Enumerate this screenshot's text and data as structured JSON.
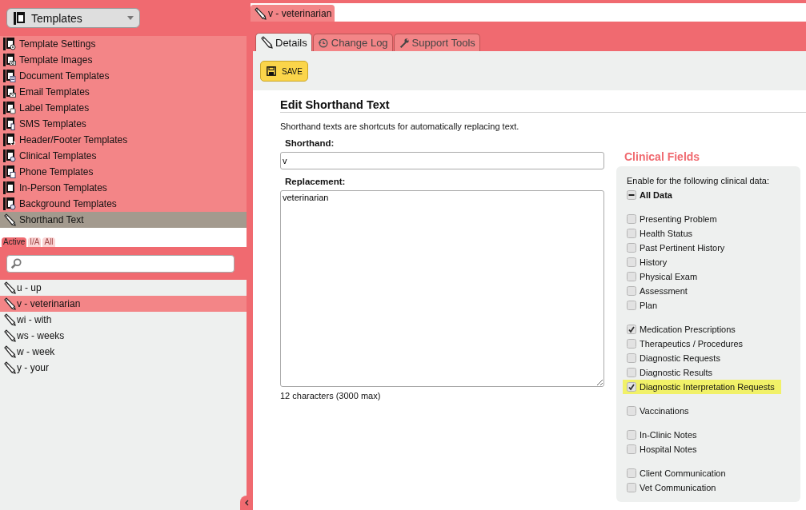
{
  "sidebar": {
    "module_select": {
      "label": "Templates"
    },
    "menu": [
      {
        "label": "Template Settings",
        "kind": "template",
        "selected": false
      },
      {
        "label": "Template Images",
        "kind": "template",
        "selected": false
      },
      {
        "label": "Document Templates",
        "kind": "template",
        "selected": false
      },
      {
        "label": "Email Templates",
        "kind": "template",
        "selected": false
      },
      {
        "label": "Label Templates",
        "kind": "template",
        "selected": false
      },
      {
        "label": "SMS Templates",
        "kind": "template",
        "selected": false
      },
      {
        "label": "Header/Footer Templates",
        "kind": "template",
        "selected": false
      },
      {
        "label": "Clinical Templates",
        "kind": "template",
        "selected": false
      },
      {
        "label": "Phone Templates",
        "kind": "template",
        "selected": false
      },
      {
        "label": "In-Person Templates",
        "kind": "template",
        "selected": false
      },
      {
        "label": "Background Templates",
        "kind": "template",
        "selected": false
      },
      {
        "label": "Shorthand Text",
        "kind": "shorthand",
        "selected": true
      }
    ],
    "filter_tabs": [
      {
        "label": "Active",
        "selected": true
      },
      {
        "label": "I/A",
        "selected": false
      },
      {
        "label": "All",
        "selected": false
      }
    ],
    "items": [
      {
        "label": "u - up",
        "selected": false
      },
      {
        "label": "v - veterinarian",
        "selected": true
      },
      {
        "label": "wi - with",
        "selected": false
      },
      {
        "label": "ws - weeks",
        "selected": false
      },
      {
        "label": "w - week",
        "selected": false
      },
      {
        "label": "y - your",
        "selected": false
      }
    ]
  },
  "document_tab": {
    "label": "v - veterinarian"
  },
  "tabs": [
    {
      "label": "Details",
      "selected": true
    },
    {
      "label": "Change Log",
      "selected": false
    },
    {
      "label": "Support Tools",
      "selected": false
    }
  ],
  "save_button": "SAVE",
  "form": {
    "title": "Edit Shorthand Text",
    "description": "Shorthand texts are shortcuts for automatically replacing text.",
    "shorthand": {
      "label": "Shorthand:",
      "value": "v"
    },
    "replacement": {
      "label": "Replacement:",
      "value": "veterinarian"
    },
    "counter": "12 characters (3000 max)"
  },
  "clinical_fields": {
    "title": "Clinical Fields",
    "prompt": "Enable for the following clinical data:",
    "all_data": {
      "label": "All Data",
      "indeterminate": true
    },
    "groups": [
      [
        {
          "label": "Presenting Problem",
          "checked": false,
          "highlighted": false
        },
        {
          "label": "Health Status",
          "checked": false,
          "highlighted": false
        },
        {
          "label": "Past Pertinent History",
          "checked": false,
          "highlighted": false
        },
        {
          "label": "History",
          "checked": false,
          "highlighted": false
        },
        {
          "label": "Physical Exam",
          "checked": false,
          "highlighted": false
        },
        {
          "label": "Assessment",
          "checked": false,
          "highlighted": false
        },
        {
          "label": "Plan",
          "checked": false,
          "highlighted": false
        }
      ],
      [
        {
          "label": "Medication Prescriptions",
          "checked": true,
          "highlighted": false
        },
        {
          "label": "Therapeutics / Procedures",
          "checked": false,
          "highlighted": false
        },
        {
          "label": "Diagnostic Requests",
          "checked": false,
          "highlighted": false
        },
        {
          "label": "Diagnostic Results",
          "checked": false,
          "highlighted": false
        },
        {
          "label": "Diagnostic Interpretation Requests",
          "checked": true,
          "highlighted": true
        }
      ],
      [
        {
          "label": "Vaccinations",
          "checked": false,
          "highlighted": false
        }
      ],
      [
        {
          "label": "In-Clinic Notes",
          "checked": false,
          "highlighted": false
        },
        {
          "label": "Hospital Notes",
          "checked": false,
          "highlighted": false
        }
      ],
      [
        {
          "label": "Client Communication",
          "checked": false,
          "highlighted": false
        },
        {
          "label": "Vet Communication",
          "checked": false,
          "highlighted": false
        }
      ]
    ]
  }
}
